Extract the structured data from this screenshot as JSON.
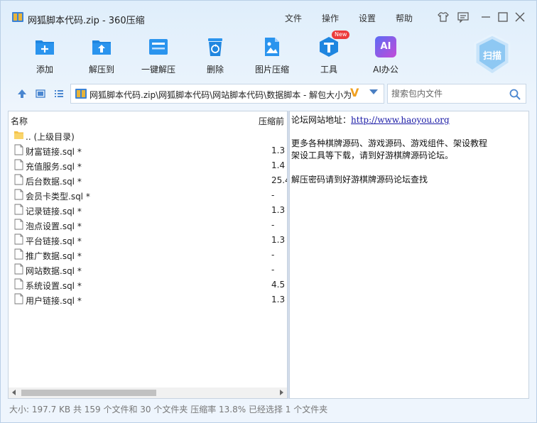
{
  "window": {
    "title": "网狐脚本代码.zip - 360压缩"
  },
  "menu": {
    "file": "文件",
    "operate": "操作",
    "settings": "设置",
    "help": "帮助"
  },
  "toolbar": {
    "add": "添加",
    "extract_to": "解压到",
    "one_click_extract": "一键解压",
    "delete": "删除",
    "image_compress": "图片压缩",
    "tools": "工具",
    "tools_badge": "New",
    "ai_office": "AI办公",
    "ai_icon_text": "AI",
    "scan": "扫描"
  },
  "address": {
    "path": "网狐脚本代码.zip\\网狐脚本代码\\网站脚本代码\\数据脚本 - 解包大小为",
    "v_mark": "V"
  },
  "search": {
    "placeholder": "搜索包内文件"
  },
  "columns": {
    "name": "名称",
    "compressed": "压缩前"
  },
  "files": [
    {
      "name": ".. (上级目录)",
      "value": ""
    },
    {
      "name": "财富链接.sql *",
      "value": "1.3"
    },
    {
      "name": "充值服务.sql *",
      "value": "1.4"
    },
    {
      "name": "后台数据.sql *",
      "value": "25.4"
    },
    {
      "name": "会员卡类型.sql *",
      "value": "-"
    },
    {
      "name": "记录链接.sql *",
      "value": "1.3"
    },
    {
      "name": "泡点设置.sql *",
      "value": "-"
    },
    {
      "name": "平台链接.sql *",
      "value": "1.3"
    },
    {
      "name": "推广数据.sql *",
      "value": "-"
    },
    {
      "name": "网站数据.sql *",
      "value": "-"
    },
    {
      "name": "系统设置.sql *",
      "value": "4.5"
    },
    {
      "name": "用户链接.sql *",
      "value": "1.3"
    }
  ],
  "comment": {
    "forum_label": "论坛网站地址：",
    "forum_link": "http://www.haoyou.org",
    "line2": "更多各种棋牌源码、游戏源码、游戏组件、架设教程",
    "line3": "架设工具等下载，请到好游棋牌源码论坛。",
    "line4": "解压密码请到好游棋牌源码论坛查找"
  },
  "status": {
    "text": "大小: 197.7 KB 共 159 个文件和 30 个文件夹 压缩率 13.8% 已经选择 1 个文件夹"
  }
}
